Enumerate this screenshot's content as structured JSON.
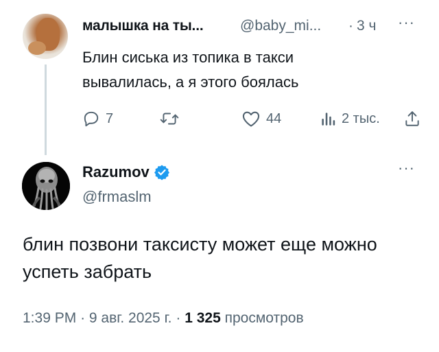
{
  "reply_to": {
    "display_name": "малышка на ты...",
    "handle": "@baby_mi...",
    "separator": "·",
    "time": "3 ч",
    "more": "···",
    "text": "Блин сиська из топика в такси вывалилась, а я этого боялась",
    "actions": {
      "replies": "7",
      "likes": "44",
      "views": "2 тыс."
    },
    "icons": [
      "reply-icon",
      "retweet-icon",
      "like-icon",
      "views-icon",
      "share-icon"
    ]
  },
  "tweet": {
    "display_name": "Razumov",
    "handle": "@frmaslm",
    "more": "···",
    "text": "блин позвони таксисту может еще можно успеть забрать",
    "time": "1:39 PM",
    "sep1": "·",
    "date": "9 авг. 2025 г.",
    "sep2": "·",
    "views_count": "1 325",
    "views_label": "просмотров",
    "verified_color": "#1d9bf0"
  }
}
